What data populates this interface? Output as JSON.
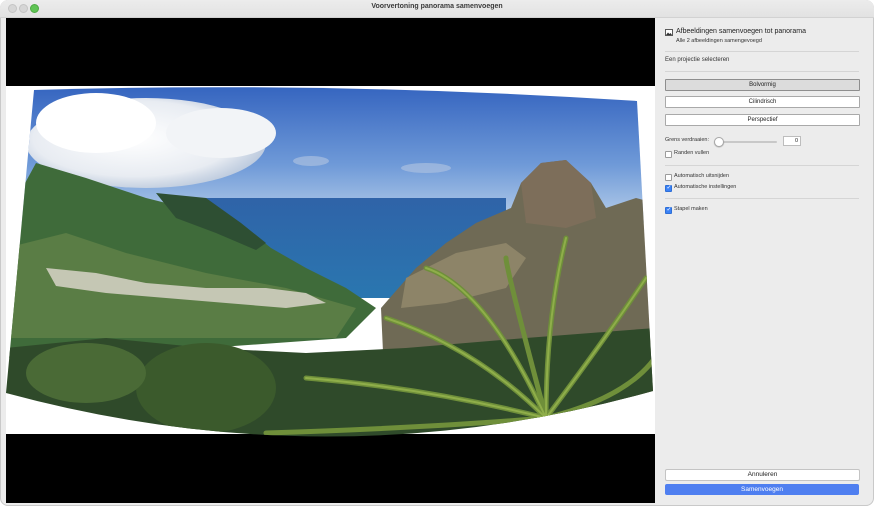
{
  "window": {
    "title": "Voorvertoning panorama samenvoegen"
  },
  "panel": {
    "header_title": "Afbeeldingen samenvoegen tot panorama",
    "header_subtitle": "Alle 2 afbeeldingen samengevoegd",
    "projection_label": "Een projectie selecteren",
    "projections": [
      {
        "label": "Bolvormig",
        "selected": true
      },
      {
        "label": "Cilindrisch",
        "selected": false
      },
      {
        "label": "Perspectief",
        "selected": false
      }
    ],
    "boundary_warp": {
      "label": "Grens verdraaien:",
      "value": "0"
    },
    "fill_edges": {
      "label": "Randen vullen",
      "checked": false
    },
    "auto_crop": {
      "label": "Automatisch uitsnijden",
      "checked": false
    },
    "auto_settings": {
      "label": "Automatische instellingen",
      "checked": true
    },
    "create_stack": {
      "label": "Stapel maken",
      "checked": true
    },
    "cancel_label": "Annuleren",
    "merge_label": "Samenvoegen"
  },
  "colors": {
    "accent": "#4f7ff0",
    "checkbox": "#3b82f6"
  },
  "icons": {
    "header": "image-icon"
  }
}
